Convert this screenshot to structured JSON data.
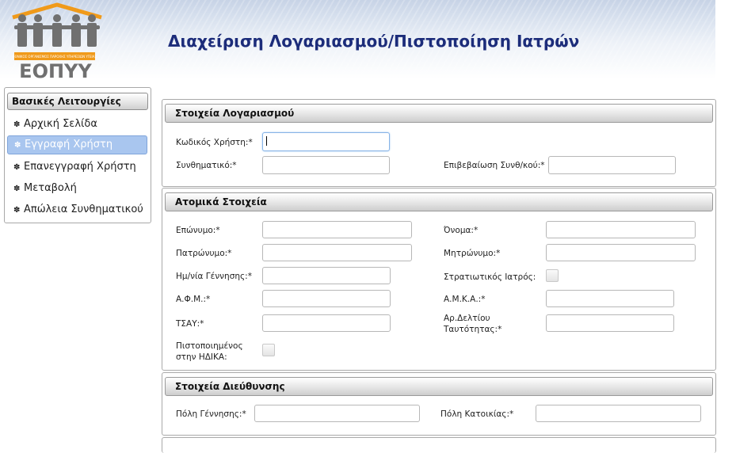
{
  "header": {
    "title": "Διαχείριση Λογαριασμού/Πιστοποίηση Ιατρών",
    "logo_text": "ΕΟΠΥΥ",
    "logo_subtext": "ΕΘΝΙΚΟΣ ΟΡΓΑΝΙΣΜΟΣ ΠΑΡΟΧΗΣ ΥΠΗΡΕΣΙΩΝ ΥΓΕΙΑΣ"
  },
  "sidebar": {
    "title": "Βασικές Λειτουργίες",
    "items": [
      {
        "label": "Αρχική Σελίδα",
        "active": false
      },
      {
        "label": "Εγγραφή Χρήστη",
        "active": true
      },
      {
        "label": "Επανεγγραφή Χρήστη",
        "active": false
      },
      {
        "label": "Μεταβολή",
        "active": false
      },
      {
        "label": "Απώλεια Συνθηματικού",
        "active": false
      }
    ]
  },
  "account": {
    "title": "Στοιχεία Λογαριασμού",
    "username_label": "Κωδικός Χρήστη:*",
    "username_value": "",
    "password_label": "Συνθηματικό:*",
    "password_value": "",
    "confirm_label": "Επιβεβαίωση Συνθ/κού:*",
    "confirm_value": ""
  },
  "personal": {
    "title": "Ατομικά Στοιχεία",
    "surname_label": "Επώνυμο:*",
    "name_label": "Όνομα:*",
    "father_label": "Πατρώνυμο:*",
    "mother_label": "Μητρώνυμο:*",
    "birthdate_label": "Ημ/νία Γέννησης:*",
    "military_label": "Στρατιωτικός Ιατρός:",
    "afm_label": "Α.Φ.Μ.:*",
    "amka_label": "Α.Μ.Κ.Α.:*",
    "tsay_label": "ΤΣΑΥ:*",
    "id_label": "Αρ.Δελτίου Ταυτότητας:*",
    "certified_label": "Πιστοποιημένος στην ΗΔΙΚΑ:"
  },
  "address": {
    "title": "Στοιχεία Διεύθυνσης",
    "birth_city_label": "Πόλη Γέννησης:*",
    "residence_city_label": "Πόλη Κατοικίας:*"
  },
  "colors": {
    "title_color": "#1c2c7a",
    "logo_orange": "#f09a1a",
    "logo_grey": "#707070",
    "active_item": "#a9c6ef"
  }
}
